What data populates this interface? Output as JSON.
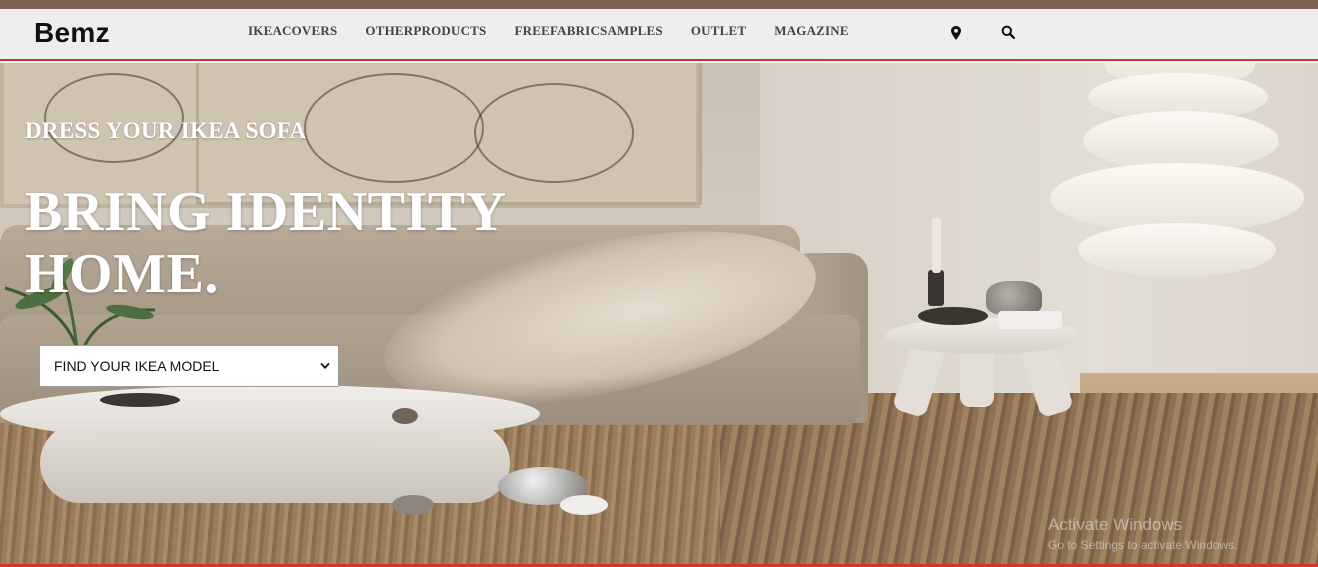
{
  "brand": {
    "logo_text": "Bemz"
  },
  "colors": {
    "top_strip": "#7e6155",
    "accent_line": "#d8322a",
    "navbar_bg": "#eeeeee",
    "hero_text": "#ffffff"
  },
  "nav": {
    "links": [
      {
        "label": "IKEACOVERS"
      },
      {
        "label": "OTHERPRODUCTS"
      },
      {
        "label": "FREEFABRICSAMPLES"
      },
      {
        "label": "OUTLET"
      },
      {
        "label": "MAGAZINE"
      }
    ],
    "icons": {
      "location": "map-pin-icon",
      "search": "search-icon"
    }
  },
  "hero": {
    "eyebrow": "DRESS YOUR IKEA SOFA",
    "headline_line1": "BRING IDENTITY",
    "headline_line2": "HOME.",
    "model_select": {
      "selected": "FIND YOUR IKEA MODEL",
      "options": [
        "FIND YOUR IKEA MODEL"
      ],
      "icon": "chevron-down-icon"
    }
  },
  "system_watermark": {
    "title": "Activate Windows",
    "subtitle": "Go to Settings to activate Windows."
  }
}
